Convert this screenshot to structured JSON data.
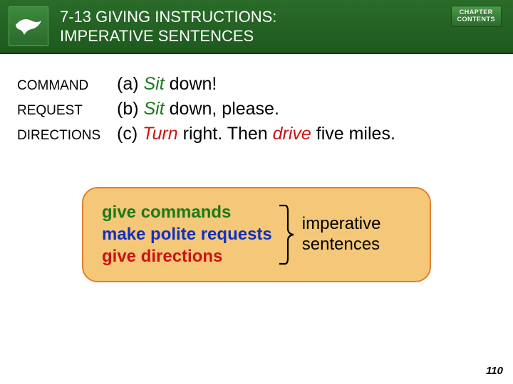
{
  "header": {
    "title": "7-13 GIVING INSTRUCTIONS: IMPERATIVE SENTENCES",
    "chapter_btn_line1": "CHAPTER",
    "chapter_btn_line2": "CONTENTS"
  },
  "labels": {
    "command": "COMMAND",
    "request": "REQUEST",
    "directions": "DIRECTIONS"
  },
  "examples": {
    "a_prefix": "(a) ",
    "a_verb": "Sit",
    "a_rest": " down!",
    "b_prefix": "(b) ",
    "b_verb": "Sit",
    "b_rest": " down, please.",
    "c_prefix": "(c) ",
    "c_verb1": "Turn",
    "c_mid": " right.  Then ",
    "c_verb2": "drive",
    "c_rest": " five miles."
  },
  "summary": {
    "line1": "give commands",
    "line2": "make polite requests",
    "line3": "give directions",
    "right1": "imperative",
    "right2": "sentences"
  },
  "page_number": "110"
}
